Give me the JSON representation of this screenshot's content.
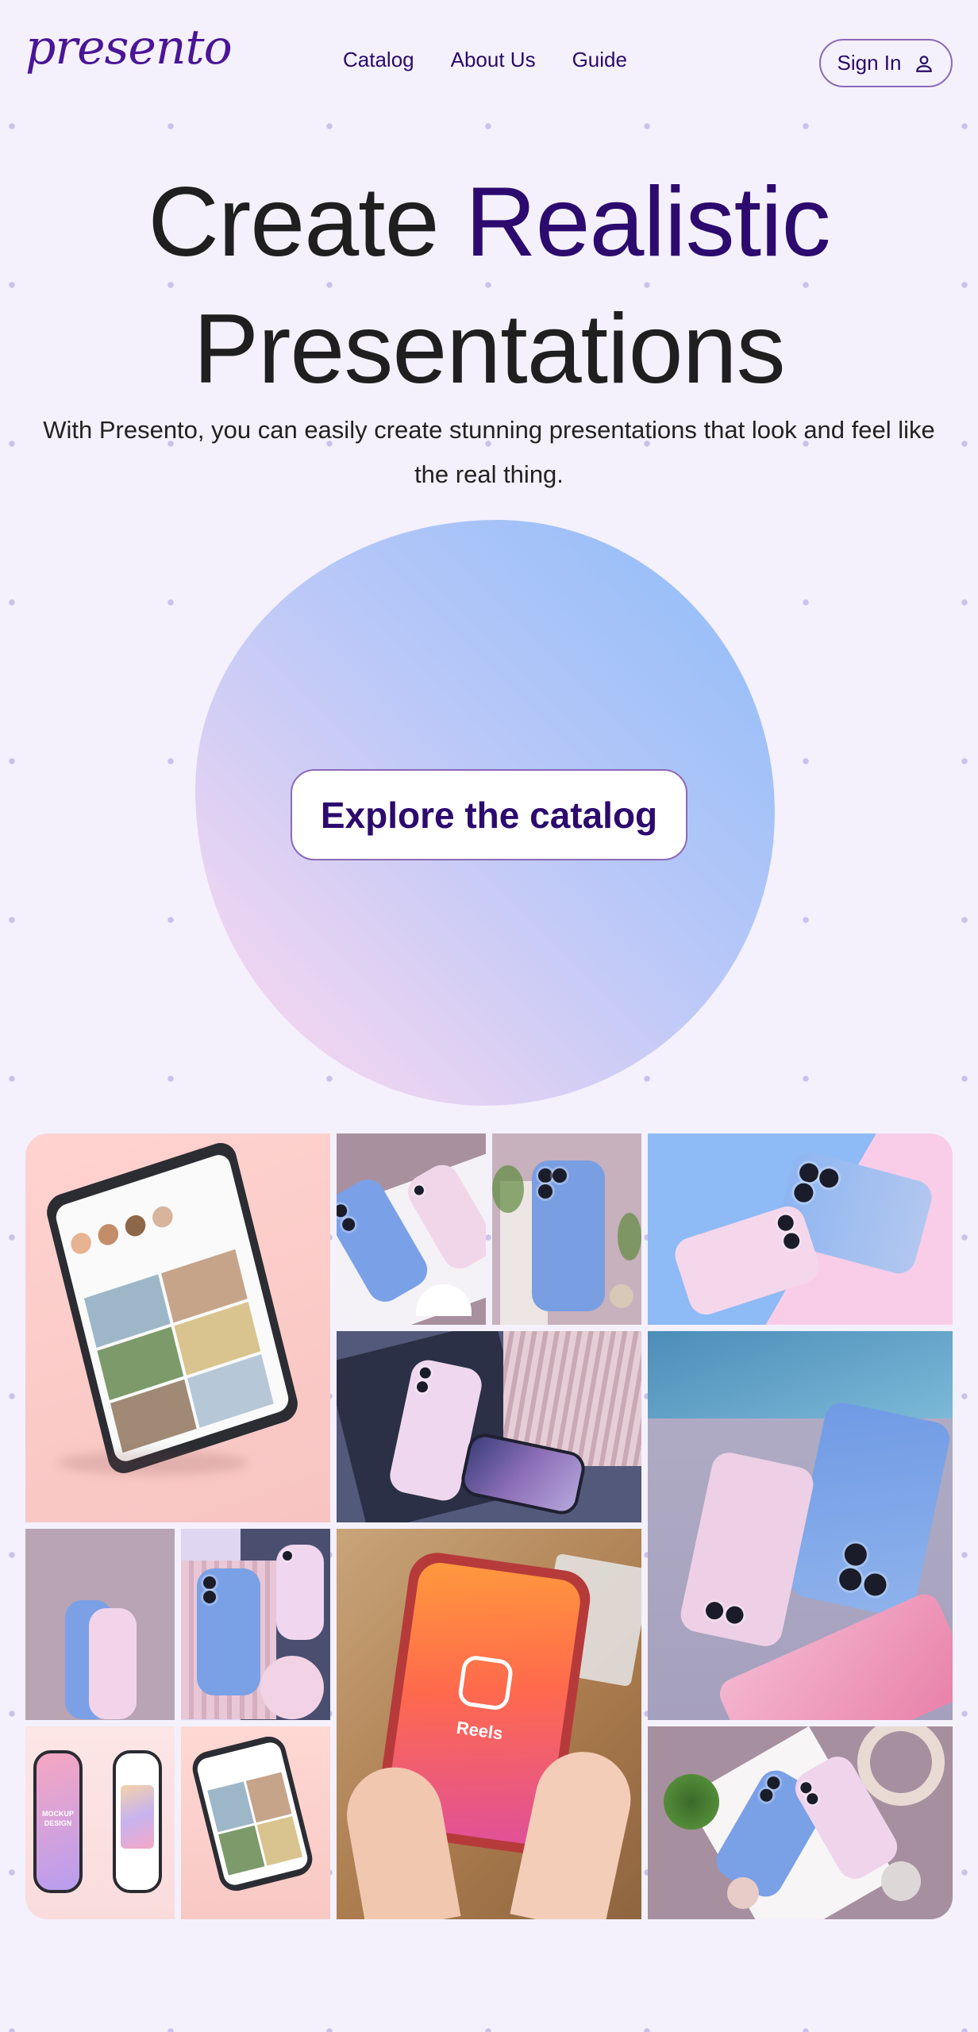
{
  "header": {
    "logo": "presento",
    "nav": [
      "Catalog",
      "About Us",
      "Guide"
    ],
    "signin_label": "Sign In"
  },
  "hero": {
    "title_part1": "Create ",
    "title_accent": "Realistic",
    "title_line2": "Presentations",
    "subtitle": "With Presento, you can easily create stunning presentations that look and feel like the real thing.",
    "cta_label": "Explore the catalog"
  },
  "gallery": {
    "reels_label": "Reels",
    "mockup_label": "MOCKUP DESIGN"
  },
  "colors": {
    "accent": "#2c0a6e",
    "background": "#f4f1fd"
  }
}
